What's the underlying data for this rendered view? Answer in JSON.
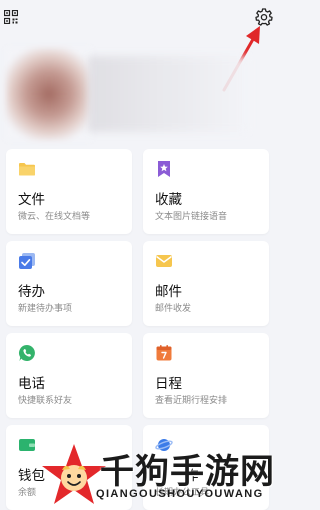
{
  "icons": {
    "qr": "qr-code-icon",
    "settings": "gear-icon"
  },
  "cards": [
    {
      "title": "文件",
      "subtitle": "微云、在线文档等",
      "icon": "folder-icon"
    },
    {
      "title": "收藏",
      "subtitle": "文本图片链接语音",
      "icon": "bookmark-icon"
    },
    {
      "title": "待办",
      "subtitle": "新建待办事项",
      "icon": "todo-icon"
    },
    {
      "title": "邮件",
      "subtitle": "邮件收发",
      "icon": "mail-icon"
    },
    {
      "title": "电话",
      "subtitle": "快捷联系好友",
      "icon": "phone-icon"
    },
    {
      "title": "日程",
      "subtitle": "查看近期行程安排",
      "icon": "calendar-icon"
    },
    {
      "title": "钱包",
      "subtitle": "余额",
      "icon": "wallet-icon"
    },
    {
      "title": "作",
      "subtitle": "长期办公工具",
      "icon": "planet-icon"
    }
  ],
  "watermark": {
    "title": "千狗手游网",
    "subtitle": "QIANGOUSHOUYOUWANG"
  },
  "colors": {
    "background": "#f3f4f8",
    "card": "#ffffff",
    "folder": "#f6c64e",
    "bookmark": "#8b5cd6",
    "todo": "#4a7be8",
    "mail": "#f6c64e",
    "phone": "#34b36b",
    "calendar": "#f07b3b",
    "wallet": "#2bb36e",
    "planet": "#3b7be8",
    "arrow": "#e0282a"
  }
}
